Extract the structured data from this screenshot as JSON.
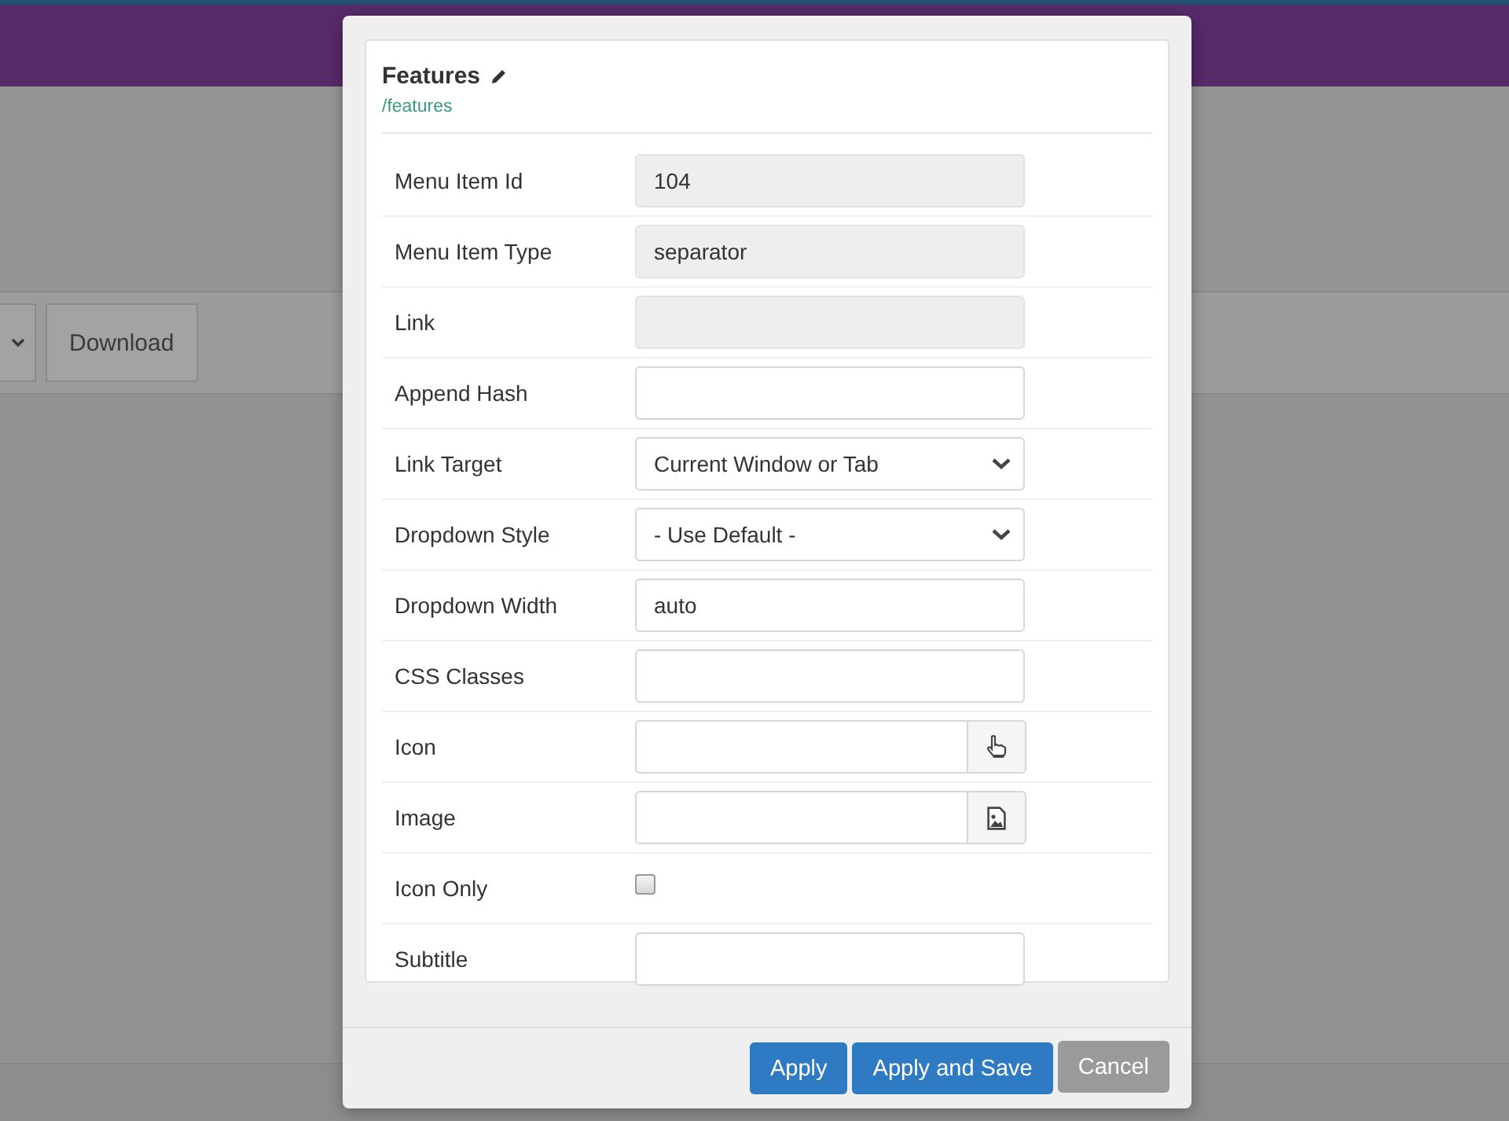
{
  "background": {
    "toolbar_buttons": [
      {
        "kind": "caret"
      },
      {
        "kind": "text",
        "label": "Download"
      }
    ]
  },
  "modal": {
    "title": "Features",
    "path": "/features",
    "fields": [
      {
        "label": "Menu Item Id",
        "kind": "readonly",
        "value": "104"
      },
      {
        "label": "Menu Item Type",
        "kind": "readonly",
        "value": "separator"
      },
      {
        "label": "Link",
        "kind": "readonly"
      },
      {
        "label": "Append Hash",
        "kind": "text"
      },
      {
        "label": "Link Target",
        "kind": "select",
        "value": "Current Window or Tab"
      },
      {
        "label": "Dropdown Style",
        "kind": "select",
        "value": "- Use Default -"
      },
      {
        "label": "Dropdown Width",
        "kind": "text",
        "value": "auto"
      },
      {
        "label": "CSS Classes",
        "kind": "text"
      },
      {
        "label": "Icon",
        "kind": "icon-picker"
      },
      {
        "label": "Image",
        "kind": "image-picker"
      },
      {
        "label": "Icon Only",
        "kind": "checkbox",
        "checked": false
      },
      {
        "label": "Subtitle",
        "kind": "text"
      }
    ],
    "buttons": [
      {
        "label": "Apply",
        "kind": "primary"
      },
      {
        "label": "Apply and Save",
        "kind": "primary"
      },
      {
        "label": "Cancel",
        "kind": "secondary"
      }
    ]
  }
}
